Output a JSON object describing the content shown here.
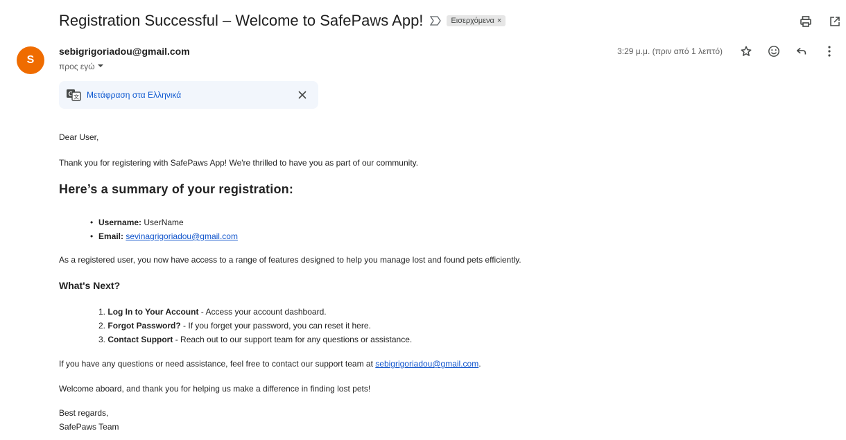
{
  "header": {
    "subject": "Registration Successful – Welcome to SafePaws App!",
    "label": "Εισερχόμενα",
    "label_close": "×",
    "actions": [
      "print-icon",
      "open-in-new-window-icon"
    ]
  },
  "message": {
    "avatar_letter": "S",
    "avatar_color": "#ef6c00",
    "sender": "sebigrigoriadou@gmail.com",
    "recipient": "προς εγώ",
    "timestamp": "3:29 μ.μ. (πριν από 1 λεπτό)",
    "actions": [
      "star-icon",
      "emoji-icon",
      "reply-icon",
      "more-vert-icon"
    ]
  },
  "translate": {
    "link": "Μετάφραση στα Ελληνικά"
  },
  "email": {
    "greeting": "Dear User,",
    "thanks": "Thank you for registering with SafePaws App! We're thrilled to have you as part of our community.",
    "summary_heading": "Here’s a summary of your registration:",
    "summary": {
      "username_label": "Username:",
      "username_value": "UserName",
      "email_label": "Email:",
      "email_value": "sevinagrigoriadou@gmail.com"
    },
    "access_text": "As a registered user, you now have access to a range of features designed to help you manage lost and found pets efficiently.",
    "next_heading": "What's Next?",
    "next_items": [
      {
        "num": "1.",
        "title": "Log In to Your Account",
        "desc": " - Access your account dashboard."
      },
      {
        "num": "2.",
        "title": "Forgot Password?",
        "desc": " - If you forget your password, you can reset it here."
      },
      {
        "num": "3.",
        "title": "Contact Support",
        "desc": " - Reach out to our support team for any questions or assistance."
      }
    ],
    "contact_prefix": "If you have any questions or need assistance, feel free to contact our support team at ",
    "contact_email": "sebigrigoriadou@gmail.com",
    "contact_suffix": ".",
    "welcome": "Welcome aboard, and thank you for helping us make a difference in finding lost pets!",
    "regards": "Best regards,",
    "team": "SafePaws Team"
  }
}
